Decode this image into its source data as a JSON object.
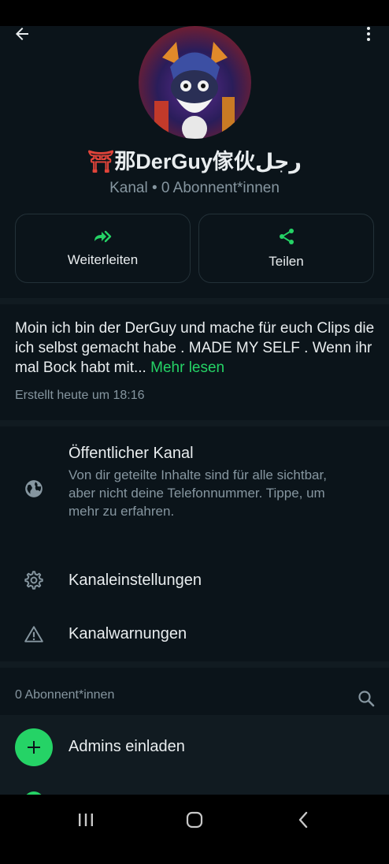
{
  "channel": {
    "title_prefix": "⛩",
    "title_main": "那DerGuy傢伙رجل",
    "subtitle": "Kanal • 0 Abonnent*innen"
  },
  "actions": {
    "forward_label": "Weiterleiten",
    "share_label": "Teilen"
  },
  "description": {
    "text": "Moin ich bin der DerGuy und mache für euch Clips die ich selbst gemacht habe . MADE MY SELF . Wenn ihr mal Bock habt mit...",
    "more_label": "Mehr lesen",
    "created": "Erstellt heute um 18:16"
  },
  "settings": {
    "public": {
      "title": "Öffentlicher Kanal",
      "subtitle": "Von dir geteilte Inhalte sind für alle sichtbar, aber nicht deine Telefonnummer. Tippe, um mehr zu erfahren."
    },
    "channel_settings": {
      "title": "Kanaleinstellungen"
    },
    "channel_warnings": {
      "title": "Kanalwarnungen"
    }
  },
  "subscribers": {
    "count_label": "0 Abonnent*innen",
    "invite_label": "Admins einladen"
  },
  "colors": {
    "accent": "#25d366",
    "background": "#0b141a",
    "secondary_text": "#8696a0"
  },
  "icons": {
    "back": "arrow-left-icon",
    "more": "three-dots-vertical-icon",
    "forward": "double-forward-arrow-icon",
    "share": "share-icon",
    "globe": "globe-icon",
    "gear": "gear-icon",
    "warning": "warning-triangle-icon",
    "search": "search-icon",
    "plus": "plus-icon"
  }
}
